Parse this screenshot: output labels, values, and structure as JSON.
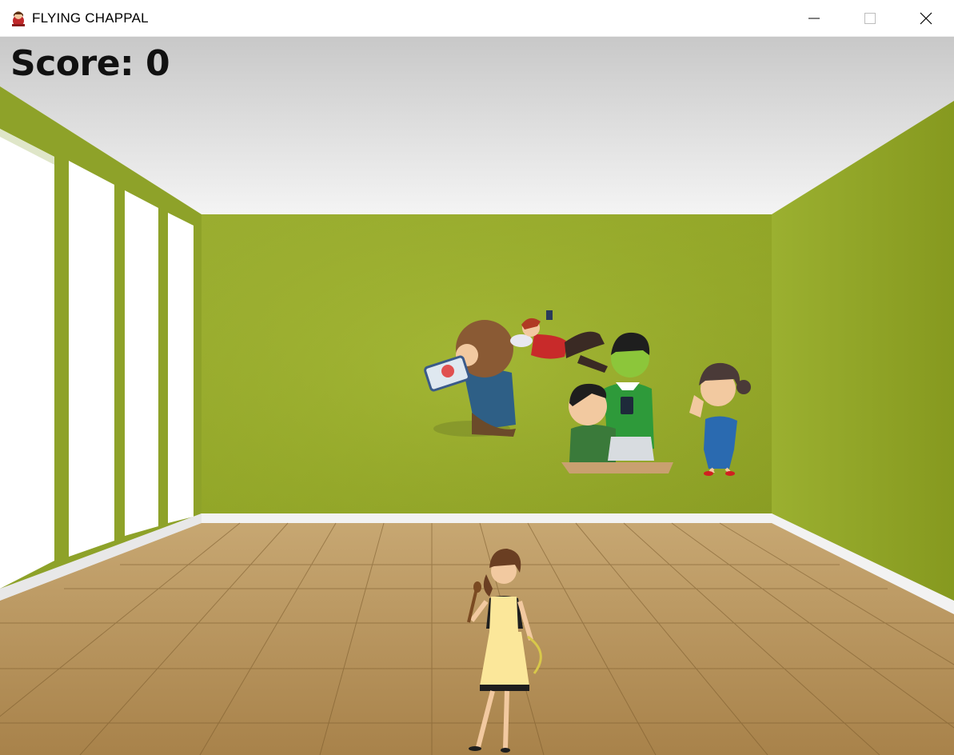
{
  "window": {
    "title": "FLYING CHAPPAL",
    "app_icon": "chappal-character-icon",
    "controls": [
      "minimize-icon",
      "maximize-icon",
      "close-icon"
    ]
  },
  "hud": {
    "score_label": "Score:",
    "score_value": 0,
    "score_text": "Score: 0"
  },
  "scene": {
    "setting": "room",
    "colors": {
      "wall": "#9aae2c",
      "side_wall": "#8ea229",
      "ceiling": "#dcdcdc",
      "floor": "#b8955a",
      "window_frame": "#7d9420",
      "window_glass": "#ffffff"
    },
    "characters": [
      "kid-with-tablet",
      "kid-lying-with-phone",
      "teen-with-phone",
      "kid-at-laptop",
      "woman-on-phone",
      "mother-with-spoon"
    ]
  }
}
